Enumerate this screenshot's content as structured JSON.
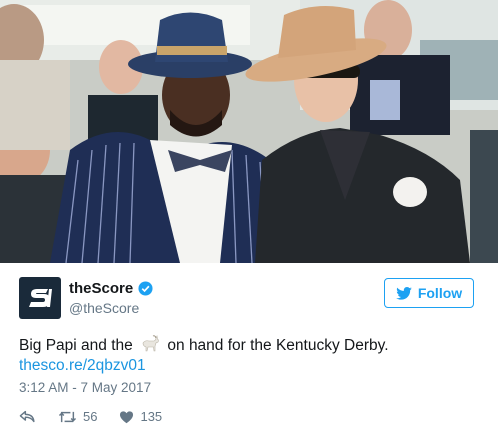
{
  "photo": {
    "description_icon": "photo-image"
  },
  "tweet": {
    "display_name": "theScore",
    "handle": "@theScore",
    "follow_label": "Follow",
    "text_before": "Big Papi and the",
    "text_after": "on hand for the Kentucky Derby.",
    "emoji": "goat-emoji",
    "link": "thesco.re/2qbzv01",
    "timestamp": "3:12 AM - 7 May 2017",
    "retweets": "56",
    "likes": "135"
  },
  "colors": {
    "accent": "#1da1f2",
    "link": "#1b95e0",
    "muted": "#657786",
    "logo_bg": "#1a2a3a"
  },
  "icons": [
    "verified-icon",
    "twitter-bird-icon",
    "reply-icon",
    "retweet-icon",
    "heart-icon"
  ]
}
